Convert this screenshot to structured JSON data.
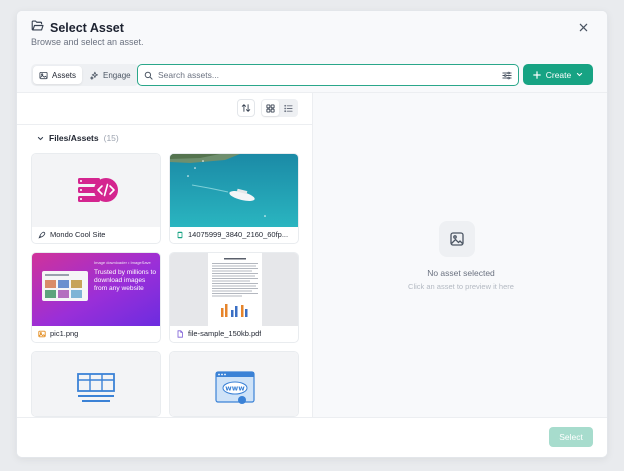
{
  "dialog": {
    "title": "Select Asset",
    "subtitle": "Browse and select an asset.",
    "close_icon": "close-icon"
  },
  "toolbar": {
    "tabs": [
      {
        "label": "Assets",
        "icon": "image-icon",
        "active": true
      },
      {
        "label": "Engage",
        "icon": "sparkles-icon",
        "active": false
      }
    ],
    "search_placeholder": "Search assets...",
    "create_label": "Create"
  },
  "browser": {
    "folder_name": "Files/Assets",
    "folder_count": "(15)",
    "view_mode": "grid",
    "items": [
      {
        "name": "Mondo Cool Site",
        "type": "site",
        "icon": "rocket-icon"
      },
      {
        "name": "14075999_3840_2160_60fp...",
        "type": "video",
        "icon": "film-icon"
      },
      {
        "name": "pic1.png",
        "type": "image",
        "icon": "image-icon"
      },
      {
        "name": "file-sample_150kb.pdf",
        "type": "pdf",
        "icon": "file-icon"
      },
      {
        "name": "",
        "type": "site",
        "icon": "layout-icon"
      },
      {
        "name": "",
        "type": "site",
        "icon": "www-icon"
      }
    ],
    "promo_text": "Trusted by millions to download images from any website",
    "promo_small": "Image downloader • ImageSave"
  },
  "preview": {
    "title": "No asset selected",
    "subtitle": "Click an asset to preview it here"
  },
  "footer": {
    "select_label": "Select"
  },
  "colors": {
    "accent": "#17a383",
    "accent_disabled": "#a7dccd",
    "search_border": "#2aa78a"
  }
}
